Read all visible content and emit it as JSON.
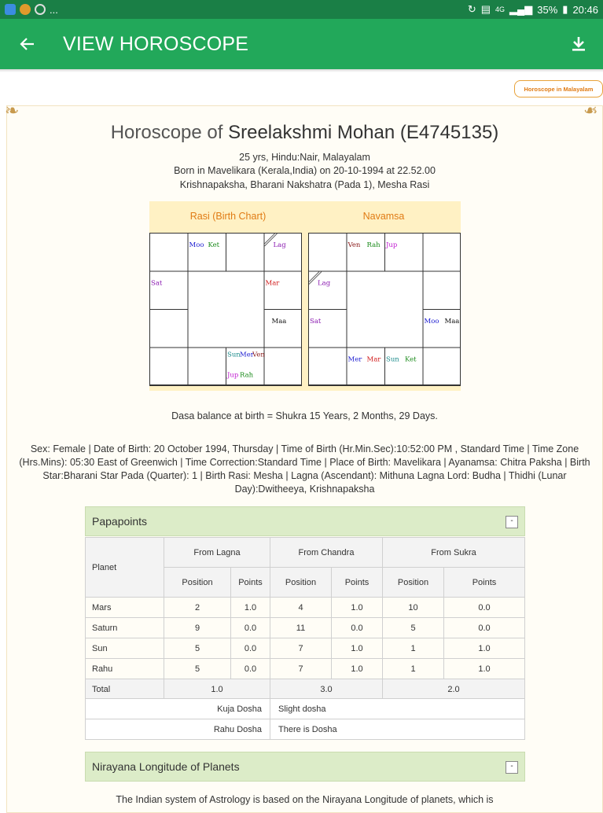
{
  "status_bar": {
    "time": "20:46",
    "battery": "35%",
    "network": "4G",
    "more": "..."
  },
  "app_bar": {
    "title": "VIEW HOROSCOPE"
  },
  "malayalam_button": "Horoscope in Malayalam",
  "header": {
    "prefix": "Horoscope of ",
    "name": "Sreelakshmi Mohan (E4745135)",
    "line1": "25 yrs, Hindu:Nair, Malayalam",
    "line2": "Born in Mavelikara (Kerala,India) on 20-10-1994 at 22.52.00",
    "line3": "Krishnapaksha, Bharani Nakshatra (Pada 1), Mesha Rasi"
  },
  "charts": [
    {
      "title": "Rasi (Birth Chart)",
      "houses": {
        "1": [
          {
            "t": "Moo",
            "c": "#1a1ad0"
          },
          {
            "t": "Ket",
            "c": "#1a8a1a"
          }
        ],
        "3": [
          {
            "t": "Lag",
            "c": "#8a1ab0"
          }
        ],
        "4": [
          {
            "t": "Sat",
            "c": "#8a1ab0"
          }
        ],
        "7": [
          {
            "t": "Mar",
            "c": "#d01a1a"
          }
        ],
        "11": [
          {
            "t": "Maa",
            "c": "#111111"
          }
        ],
        "14": [
          {
            "t": "Sun",
            "c": "#1a8a8a"
          },
          {
            "t": "Mer",
            "c": "#1a1ad0"
          },
          {
            "t": "Ven",
            "c": "#8a1a1a"
          },
          {
            "t": "Jup",
            "c": "#c01ad0"
          },
          {
            "t": "Rah",
            "c": "#1a8a1a"
          }
        ]
      }
    },
    {
      "title": "Navamsa",
      "houses": {
        "1": [
          {
            "t": "Ven",
            "c": "#8a1a1a"
          },
          {
            "t": "Rah",
            "c": "#1a8a1a"
          }
        ],
        "2": [
          {
            "t": "Jup",
            "c": "#c01ad0"
          }
        ],
        "4": [
          {
            "t": "Lag",
            "c": "#8a1ab0"
          }
        ],
        "8": [
          {
            "t": "Sat",
            "c": "#8a1ab0"
          }
        ],
        "11": [
          {
            "t": "Moo",
            "c": "#1a1ad0"
          },
          {
            "t": "Maa",
            "c": "#111111"
          }
        ],
        "13": [
          {
            "t": "Mer",
            "c": "#1a1ad0"
          },
          {
            "t": "Mar",
            "c": "#d01a1a"
          }
        ],
        "14": [
          {
            "t": "Sun",
            "c": "#1a8a8a"
          },
          {
            "t": "Ket",
            "c": "#1a8a1a"
          }
        ]
      }
    }
  ],
  "dasa": "Dasa balance at birth = Shukra 15 Years, 2 Months, 29 Days.",
  "details": "Sex: Female | Date of Birth: 20 October 1994, Thursday | Time of Birth (Hr.Min.Sec):10:52:00 PM , Standard Time | Time Zone (Hrs.Mins): 05:30 East of Greenwich | Time Correction:Standard Time | Place of Birth: Mavelikara | Ayanamsa: Chitra Paksha | Birth Star:Bharani Star Pada (Quarter): 1 | Birth Rasi: Mesha | Lagna (Ascendant): Mithuna Lagna Lord: Budha | Thidhi (Lunar Day):Dwitheeya, Krishnapaksha",
  "papapoints": {
    "title": "Papapoints",
    "collapse_label": "-",
    "header": {
      "planet": "Planet",
      "groups": [
        "From Lagna",
        "From Chandra",
        "From Sukra"
      ],
      "position": "Position",
      "points": "Points"
    },
    "rows": [
      [
        "Mars",
        "2",
        "1.0",
        "4",
        "1.0",
        "10",
        "0.0"
      ],
      [
        "Saturn",
        "9",
        "0.0",
        "11",
        "0.0",
        "5",
        "0.0"
      ],
      [
        "Sun",
        "5",
        "0.0",
        "7",
        "1.0",
        "1",
        "1.0"
      ],
      [
        "Rahu",
        "5",
        "0.0",
        "7",
        "1.0",
        "1",
        "1.0"
      ]
    ],
    "total": [
      "Total",
      "1.0",
      "3.0",
      "2.0"
    ],
    "dosha": [
      [
        "Kuja Dosha",
        "Slight dosha"
      ],
      [
        "Rahu Dosha",
        "There is Dosha"
      ]
    ]
  },
  "nirayana": {
    "title": "Nirayana Longitude of Planets",
    "collapse_label": "-",
    "text": "The Indian system of Astrology is based on the Nirayana Longitude of planets, which is"
  }
}
